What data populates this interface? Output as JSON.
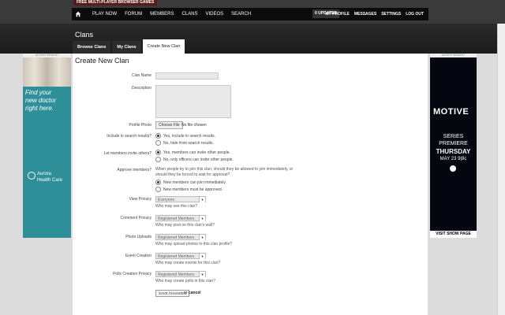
{
  "banner": {
    "tag": "FREE MULTI-PLAYER BROWSER GAMES"
  },
  "nav": {
    "items": [
      "PLAY NOW",
      "FORUM",
      "MEMBERS",
      "CLANS",
      "VIDEOS",
      "SEARCH"
    ],
    "updates": "0 UPDATES",
    "right_items": [
      "MY PROFILE",
      "MESSAGES",
      "SETTINGS",
      "LOG OUT"
    ]
  },
  "page": {
    "title": "Clans",
    "tabs": [
      "Browse Clans",
      "My Clans",
      "Create New Clan"
    ],
    "heading": "Create New Clan"
  },
  "form": {
    "clan_name_label": "Clan Name",
    "description_label": "Description",
    "profile_photo_label": "Profile Photo",
    "choose_file": "Choose File",
    "no_file": "No file chosen",
    "include_search_label": "Include in search results?",
    "include_yes": "Yes, include in search results.",
    "include_no": "No, hide from search results.",
    "invite_label": "Let members invite others?",
    "invite_yes": "Yes, members can invite other people.",
    "invite_no": "No, only officers can invite other people.",
    "approve_label": "Approve members?",
    "approve_help_1": "When people try to join this clan, should they be allowed to join immediately, or",
    "approve_help_2": "should they be forced to wait for approval?",
    "approve_yes": "New members can join immediately.",
    "approve_no": "New members must be approved.",
    "view_privacy_label": "View Privacy",
    "view_privacy_value": "Everyone",
    "view_privacy_help": "Who may see this clan?",
    "comment_privacy_label": "Comment Privacy",
    "comment_privacy_value": "Registered Members",
    "comment_privacy_help": "Who may post on this clan's wall?",
    "photo_uploads_label": "Photo Uploads",
    "photo_uploads_value": "Registered Members",
    "photo_uploads_help": "Who may upload photos to this clan profile?",
    "event_creation_label": "Event Creation",
    "event_creation_value": "Registered Members",
    "event_creation_help": "Who may create events for this clan?",
    "polls_creation_label": "Polls Creation Privacy",
    "polls_creation_value": "Registered Members",
    "polls_creation_help": "Who may create polls in this clan?",
    "save_button": "SAVE CHANGES",
    "or_text": "or",
    "cancel_link": "cancel"
  },
  "ads": {
    "tag": "ADVERTISEMENT",
    "left_line1": "Find your",
    "left_line2": "new doctor",
    "left_line3": "right here.",
    "left_brand1": "Aurora",
    "left_brand2": "Health Care",
    "right_logo": "MOTIVE",
    "right_line1": "SERIES",
    "right_line2": "PREMIERE",
    "right_line3": "THURSDAY",
    "right_line4": "MAY 23 9|8c",
    "right_cta": "VISIT SHOW PAGE"
  }
}
